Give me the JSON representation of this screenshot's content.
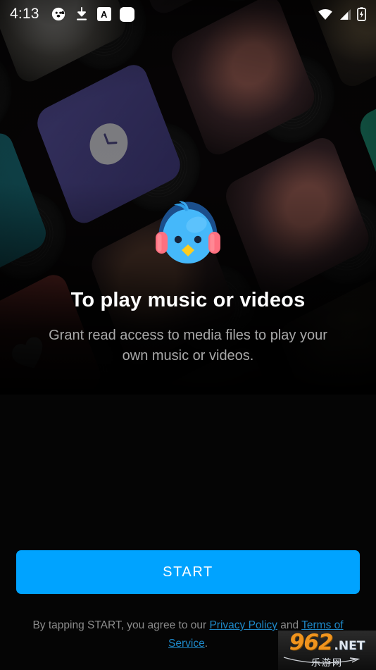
{
  "status_bar": {
    "time": "4:13",
    "left_icons": [
      {
        "name": "panda-app-icon",
        "glyph": "panda"
      },
      {
        "name": "download-icon",
        "glyph": "download"
      },
      {
        "name": "app-letter-icon",
        "glyph": "A"
      },
      {
        "name": "rounded-square-icon",
        "glyph": "square"
      }
    ],
    "right_icons": [
      {
        "name": "wifi-icon",
        "glyph": "wifi"
      },
      {
        "name": "cellular-signal-icon",
        "glyph": "signal"
      },
      {
        "name": "battery-charging-icon",
        "glyph": "battery-charging"
      }
    ]
  },
  "permission": {
    "mascot_name": "lark-bird-mascot",
    "headline": "To play music or videos",
    "description": "Grant read access to media files to play your own music or videos."
  },
  "actions": {
    "start_label": "START"
  },
  "legal": {
    "prefix": "By tapping START, you agree to our ",
    "privacy_label": "Privacy Policy",
    "conjunction": " and ",
    "terms_label": "Terms of Service",
    "suffix": "."
  },
  "watermark": {
    "brand": "962",
    "tld": ".NET",
    "cn_text": "乐游网"
  },
  "colors": {
    "accent_blue": "#00a3ff",
    "link_blue": "#1e88c7",
    "background": "#000000",
    "headline": "#ffffff",
    "subtext": "#a9a9a9",
    "mascot_body": "#45b8fa",
    "mascot_headphone": "#ff7080",
    "mascot_beak": "#ffcc1f",
    "card_teal": "#1d7b85",
    "card_purple": "#4a4287",
    "card_red": "#a8453f",
    "card_green": "#1f8f74"
  },
  "background_cards": [
    {
      "name": "album-card-photo-astronaut",
      "style": "c-teal",
      "glyph": "none",
      "vinyl": true
    },
    {
      "name": "album-card-recent",
      "style": "c-purple",
      "glyph": "clock",
      "vinyl": true
    },
    {
      "name": "album-card-favorites",
      "style": "c-red",
      "glyph": "heart",
      "vinyl": true
    },
    {
      "name": "album-card-green",
      "style": "c-green",
      "glyph": "none",
      "vinyl": true
    }
  ]
}
